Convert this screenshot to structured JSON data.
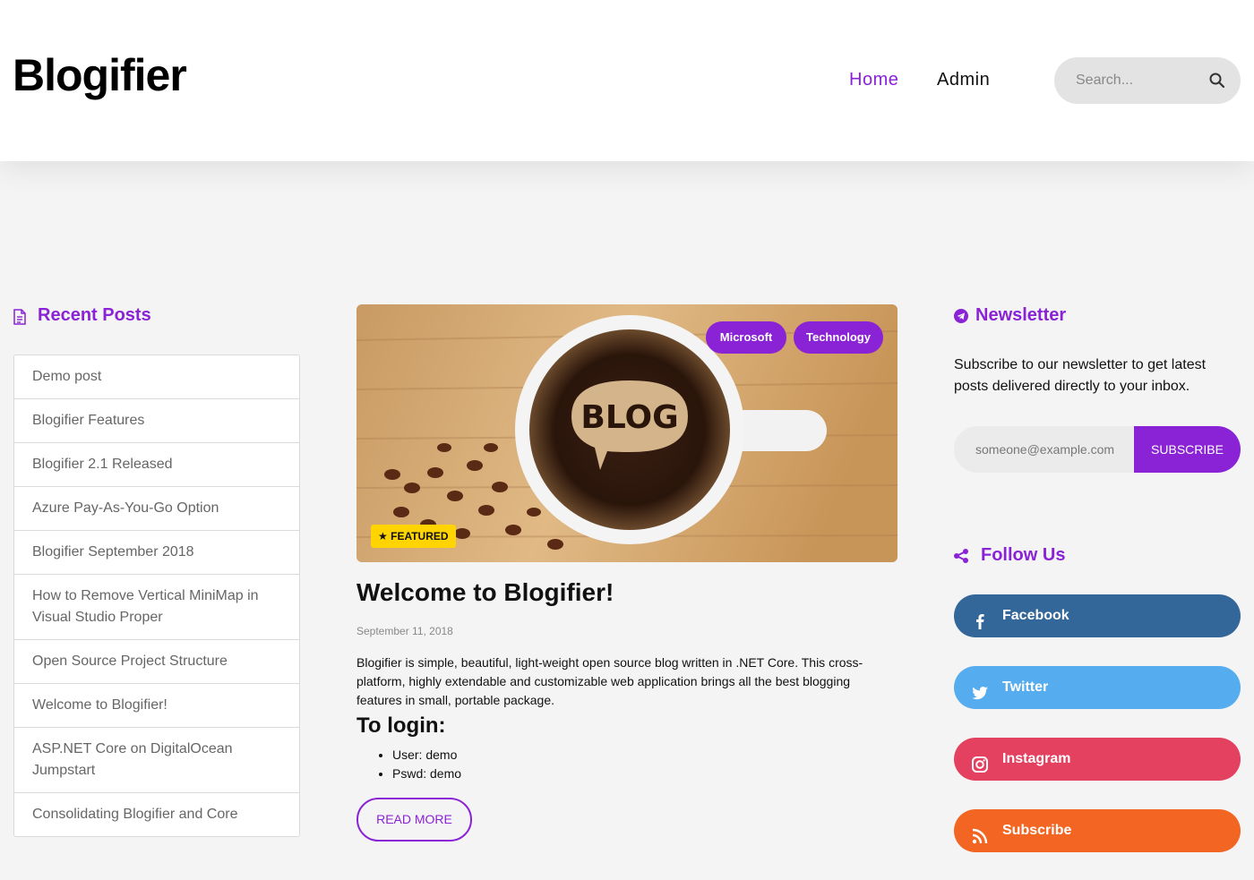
{
  "header": {
    "logo": "Blogifier",
    "nav": {
      "home": "Home",
      "admin": "Admin"
    },
    "search": {
      "placeholder": "Search..."
    }
  },
  "sidebar_left": {
    "title": "Recent Posts",
    "posts": [
      "Demo post",
      "Blogifier Features",
      "Blogifier 2.1 Released",
      "Azure Pay-As-You-Go Option",
      "Blogifier September 2018",
      "How to Remove Vertical MiniMap in Visual Studio Proper",
      "Open Source Project Structure",
      "Welcome to Blogifier!",
      "ASP.NET Core on DigitalOcean Jumpstart",
      "Consolidating Blogifier and Core"
    ]
  },
  "post": {
    "image_text": "BLOG",
    "tags": [
      "Microsoft",
      "Technology"
    ],
    "featured": "FEATURED",
    "title": "Welcome to Blogifier!",
    "date": "September 11, 2018",
    "body": "Blogifier is simple, beautiful, light-weight open source blog written in .NET Core. This cross-platform, highly extendable and customizable web application brings all the best blogging features in small, portable package.",
    "subheading": "To login:",
    "list": [
      "User: demo",
      "Pswd: demo"
    ],
    "read_more": "READ MORE"
  },
  "newsletter": {
    "title": "Newsletter",
    "text": "Subscribe to our newsletter to get latest posts delivered directly to your inbox.",
    "placeholder": "someone@example.com",
    "button": "SUBSCRIBE"
  },
  "follow": {
    "title": "Follow Us",
    "links": [
      {
        "label": "Facebook",
        "icon": "facebook-icon",
        "color": "#336699"
      },
      {
        "label": "Twitter",
        "icon": "twitter-icon",
        "color": "#55acee"
      },
      {
        "label": "Instagram",
        "icon": "instagram-icon",
        "color": "#e4405f"
      },
      {
        "label": "Subscribe",
        "icon": "rss-icon",
        "color": "#f26522"
      }
    ]
  },
  "colors": {
    "accent": "#8a22d6",
    "featured": "#ffd400",
    "background": "#f4f4f5"
  }
}
